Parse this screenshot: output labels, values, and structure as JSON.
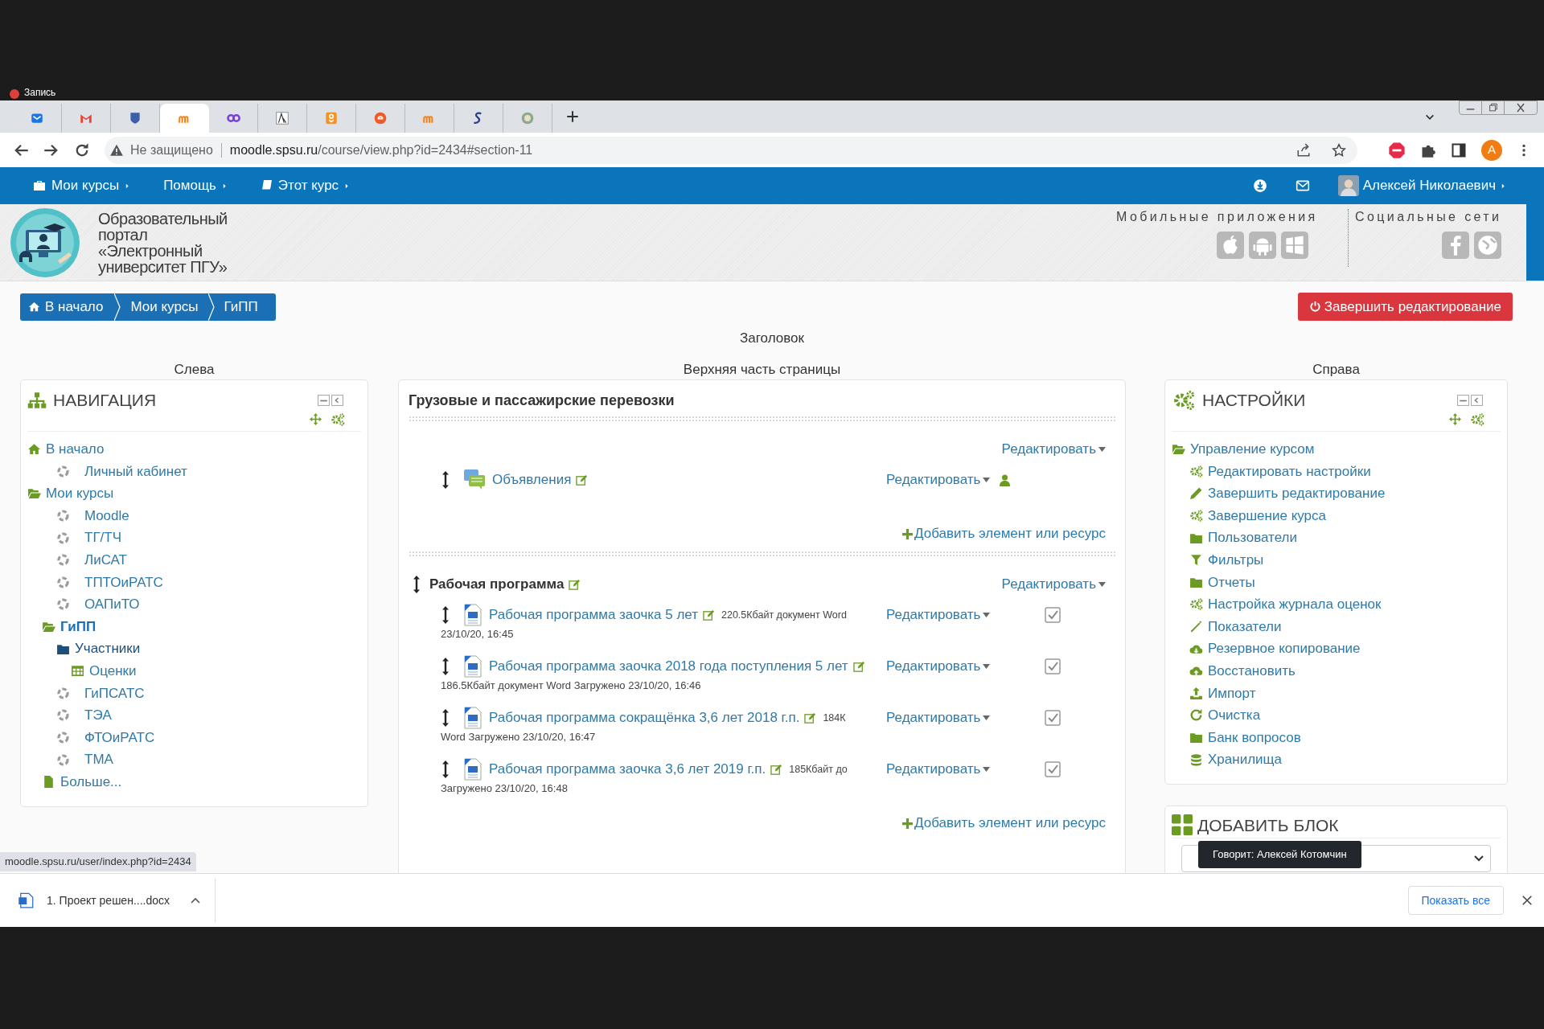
{
  "recording": {
    "label": "Запись"
  },
  "browser": {
    "tabs": [
      {
        "selected": false
      },
      {
        "selected": false
      },
      {
        "selected": false
      },
      {
        "selected": true
      },
      {
        "selected": false
      },
      {
        "selected": false
      },
      {
        "selected": false
      },
      {
        "selected": false
      },
      {
        "selected": false
      },
      {
        "selected": false
      },
      {
        "selected": false
      }
    ],
    "address": {
      "warning": "Не защищено",
      "host": "moodle.spsu.ru",
      "path": "/course/view.php?id=2434#section-11"
    },
    "profile_initial": "A"
  },
  "navbar": {
    "menus": [
      {
        "label": "Мои курсы",
        "kind": "briefcase"
      },
      {
        "label": "Помощь",
        "kind": "plain"
      },
      {
        "label": "Этот курс",
        "kind": "book"
      }
    ],
    "user": "Алексей Николаевич"
  },
  "header": {
    "title_lines": [
      "Образовательный",
      "портал",
      "«Электронный",
      "университет ПГУ»"
    ],
    "mobile_label": "Мобильные приложения",
    "social_label": "Социальные сети"
  },
  "breadcrumb": [
    {
      "label": "В начало",
      "kind": "home"
    },
    {
      "label": "Мои курсы",
      "kind": "plain"
    },
    {
      "label": "ГиПП",
      "kind": "plain"
    }
  ],
  "end_editing_button": "Завершить редактирование",
  "region_title": "Заголовок",
  "columns": {
    "left": "Слева",
    "center": "Верхняя часть страницы",
    "right": "Справа"
  },
  "navigation": {
    "title": "НАВИГАЦИЯ",
    "tree": [
      {
        "label": "В начало",
        "kind": "home",
        "children": [
          {
            "label": "Личный кабинет",
            "kind": "course"
          }
        ]
      },
      {
        "label": "Мои курсы",
        "kind": "folder-open",
        "children": [
          {
            "label": "Moodle",
            "kind": "course"
          },
          {
            "label": "ТГ/ТЧ",
            "kind": "course"
          },
          {
            "label": "ЛиСАТ",
            "kind": "course"
          },
          {
            "label": "ТПТОиРАТС",
            "kind": "course"
          },
          {
            "label": "ОАПиТО",
            "kind": "course"
          },
          {
            "label": "ГиПП",
            "kind": "current",
            "children": [
              {
                "label": "Участники",
                "kind": "folder",
                "children": [
                  {
                    "label": "Оценки",
                    "kind": "table"
                  }
                ]
              }
            ]
          },
          {
            "label": "ГиПСАТС",
            "kind": "course"
          },
          {
            "label": "ТЭА",
            "kind": "course"
          },
          {
            "label": "ФТОиРАТС",
            "kind": "course"
          },
          {
            "label": "ТМА",
            "kind": "course"
          },
          {
            "label": "Больше...",
            "kind": "file"
          }
        ]
      }
    ]
  },
  "course": {
    "title": "Грузовые и пассажирские перевозки",
    "sections": [
      {
        "edit": "Редактировать",
        "activities": [
          {
            "kind": "forum",
            "title": "Объявления",
            "edit": "Редактировать"
          }
        ],
        "add": "Добавить элемент или ресурс"
      },
      {
        "name": "Рабочая программа",
        "edit": "Редактировать",
        "activities": [
          {
            "kind": "file",
            "title": "Рабочая программа заочка 5 лет",
            "meta": "220.5Кбайт документ Word",
            "details": "23/10/20, 16:45",
            "edit": "Редактировать",
            "checked": true
          },
          {
            "kind": "file",
            "title": "Рабочая программа заочка 2018 года поступления 5 лет",
            "details": "186.5Кбайт документ Word Загружено 23/10/20, 16:46",
            "edit": "Редактировать",
            "checked": true
          },
          {
            "kind": "file",
            "title": "Рабочая программа сокращёнка 3,6 лет 2018 г.п.",
            "meta": "184К",
            "details": "Word Загружено 23/10/20, 16:47",
            "edit": "Редактировать",
            "checked": true
          },
          {
            "kind": "file",
            "title": "Рабочая программа заочка 3,6 лет 2019 г.п.",
            "meta": "185Кбайт до",
            "details": "Загружено 23/10/20, 16:48",
            "edit": "Редактировать",
            "checked": true
          }
        ],
        "add": "Добавить элемент или ресурс"
      }
    ]
  },
  "settings": {
    "title": "НАСТРОЙКИ",
    "tree": [
      {
        "label": "Управление курсом",
        "kind": "folder-open",
        "children": [
          {
            "label": "Редактировать настройки",
            "kind": "gears"
          },
          {
            "label": "Завершить редактирование",
            "kind": "pencil"
          },
          {
            "label": "Завершение курса",
            "kind": "gears"
          },
          {
            "label": "Пользователи",
            "kind": "folder"
          },
          {
            "label": "Фильтры",
            "kind": "filter"
          },
          {
            "label": "Отчеты",
            "kind": "folder"
          },
          {
            "label": "Настройка журнала оценок",
            "kind": "gears"
          },
          {
            "label": "Показатели",
            "kind": "wand"
          },
          {
            "label": "Резервное копирование",
            "kind": "cloud-down"
          },
          {
            "label": "Восстановить",
            "kind": "cloud-up"
          },
          {
            "label": "Импорт",
            "kind": "upload"
          },
          {
            "label": "Очистка",
            "kind": "refresh"
          },
          {
            "label": "Банк вопросов",
            "kind": "folder"
          },
          {
            "label": "Хранилища",
            "kind": "database"
          }
        ]
      }
    ]
  },
  "add_block": {
    "title": "ДОБАВИТЬ БЛОК"
  },
  "status_url": "moodle.spsu.ru/user/index.php?id=2434",
  "speaker_tooltip": "Говорит: Алексей Котомчин",
  "downloads": {
    "items": [
      {
        "name": "1. Проект решен....docx"
      }
    ],
    "show_all": "Показать все"
  }
}
